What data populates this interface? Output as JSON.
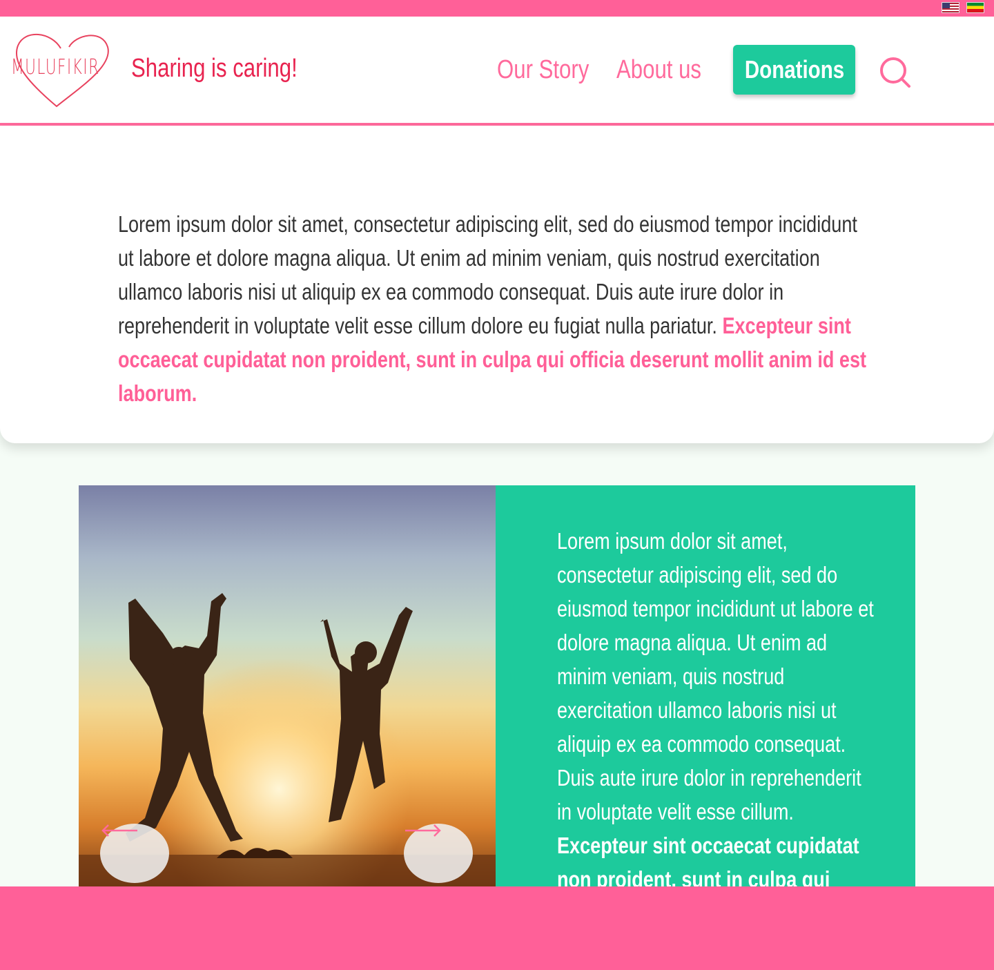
{
  "topbar": {
    "languages": [
      {
        "name": "English",
        "icon": "us-flag-icon"
      },
      {
        "name": "Amharic",
        "icon": "ethiopia-flag-icon"
      }
    ]
  },
  "header": {
    "logo_text": "MULUFIKIR",
    "tagline": "Sharing is caring!",
    "nav": {
      "our_story": "Our Story",
      "about_us": "About us",
      "donations": "Donations"
    },
    "search_icon": "search-icon"
  },
  "intro": {
    "text": "Lorem ipsum dolor sit amet, consectetur adipiscing elit, sed do eiusmod tempor incididunt ut labore et dolore magna aliqua. Ut enim ad minim veniam, quis nostrud exercitation ullamco laboris nisi ut aliquip ex ea commodo consequat. Duis aute irure dolor in reprehenderit in voluptate velit esse cillum dolore eu fugiat nulla pariatur. ",
    "highlight": "Excepteur sint occaecat cupidatat non proident, sunt in culpa qui officia deserunt mollit anim id est laborum."
  },
  "feature": {
    "text": "Lorem ipsum dolor sit amet, consectetur adipiscing elit, sed do eiusmod tempor incididunt ut labore et dolore magna aliqua. Ut enim ad minim veniam, quis nostrud exercitation ullamco laboris nisi ut aliquip ex ea commodo consequat. Duis aute irure dolor in reprehenderit in voluptate velit esse cillum. ",
    "strong": "Excepteur sint occaecat cupidatat non proident, sunt in culpa qui officia deserunt mollit anim id est laborum.",
    "prev_icon": "arrow-left-icon",
    "next_icon": "arrow-right-icon"
  },
  "colors": {
    "brand_pink": "#ff6098",
    "accent_green": "#1dca9c",
    "tagline_red": "#e8234f"
  }
}
